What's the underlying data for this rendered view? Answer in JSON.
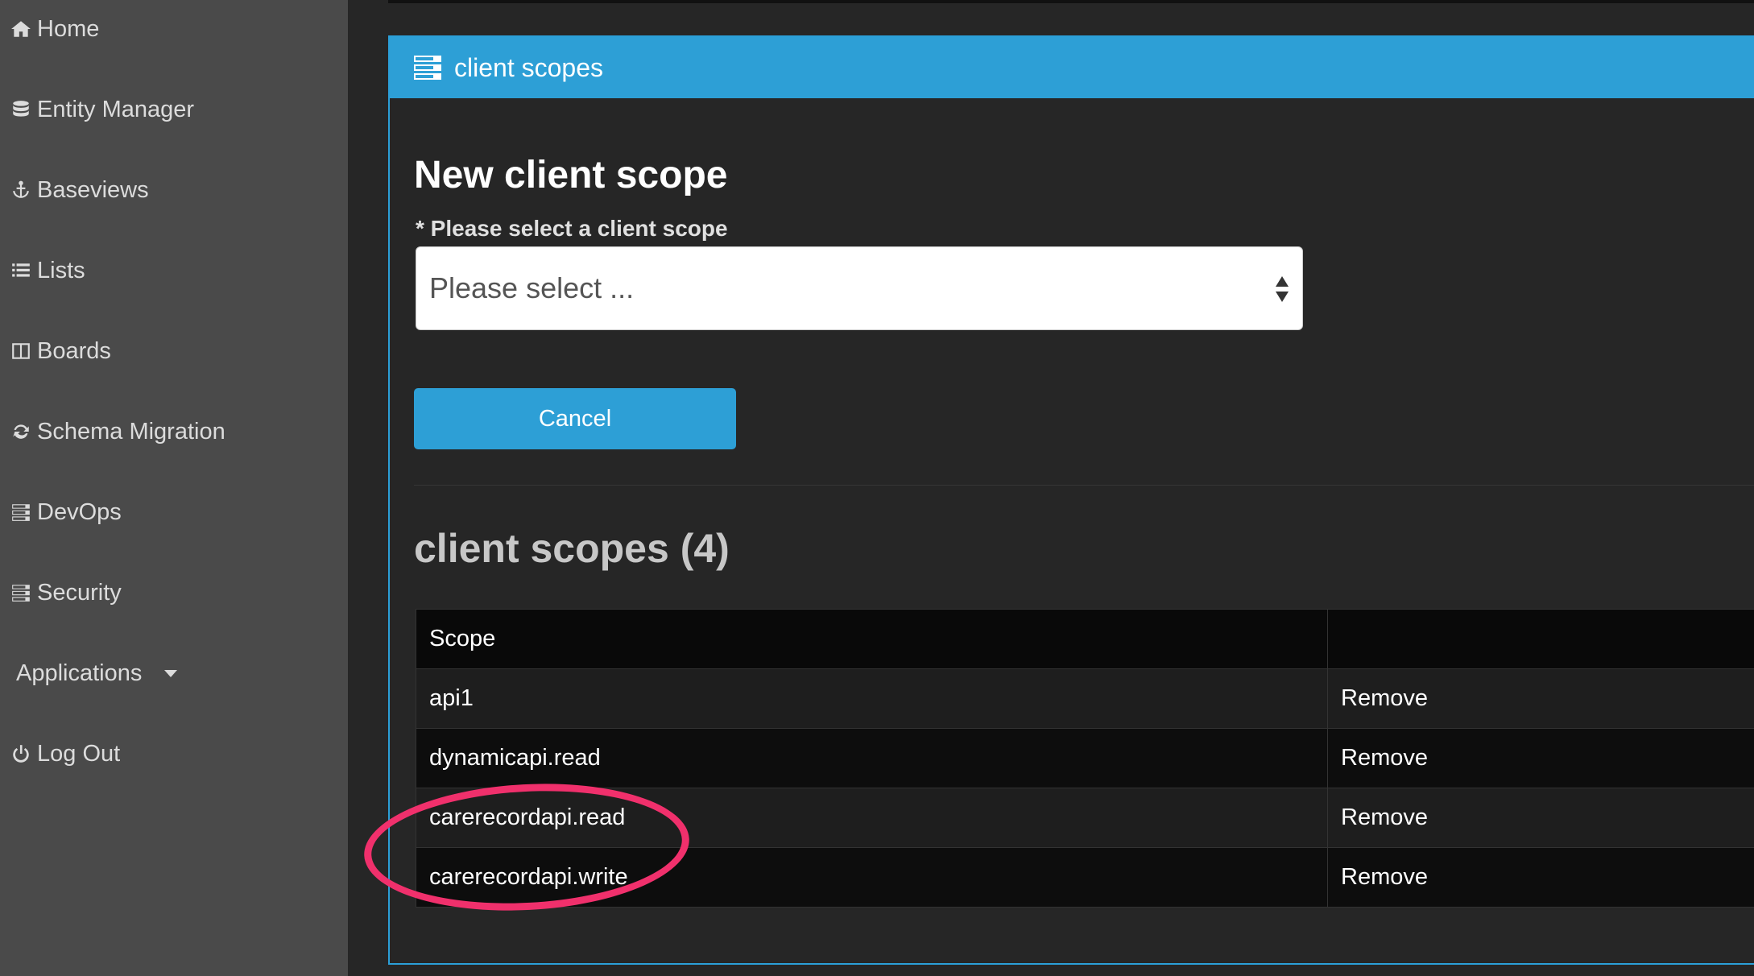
{
  "sidebar": {
    "items": [
      {
        "label": "Home",
        "icon": "home-icon"
      },
      {
        "label": "Entity Manager",
        "icon": "database-icon"
      },
      {
        "label": "Baseviews",
        "icon": "anchor-icon"
      },
      {
        "label": "Lists",
        "icon": "list-icon"
      },
      {
        "label": "Boards",
        "icon": "columns-icon"
      },
      {
        "label": "Schema Migration",
        "icon": "refresh-icon"
      },
      {
        "label": "DevOps",
        "icon": "server-icon"
      },
      {
        "label": "Security",
        "icon": "server-icon"
      },
      {
        "label": "Applications",
        "icon": "chevron-down-icon"
      },
      {
        "label": "Log Out",
        "icon": "power-icon"
      }
    ]
  },
  "panel": {
    "title": "client scopes",
    "form": {
      "heading": "New client scope",
      "label": "* Please select a client scope",
      "select_value": "Please select ...",
      "cancel_label": "Cancel"
    },
    "list": {
      "heading": "client scopes (4)",
      "columns": [
        "Scope",
        ""
      ],
      "rows": [
        {
          "scope": "api1",
          "action": "Remove"
        },
        {
          "scope": "dynamicapi.read",
          "action": "Remove"
        },
        {
          "scope": "carerecordapi.read",
          "action": "Remove"
        },
        {
          "scope": "carerecordapi.write",
          "action": "Remove"
        }
      ]
    }
  },
  "colors": {
    "accent": "#2d9fd6",
    "sidebar_bg": "#4a4a4a",
    "page_bg": "#262626",
    "annotation": "#f0306c"
  }
}
